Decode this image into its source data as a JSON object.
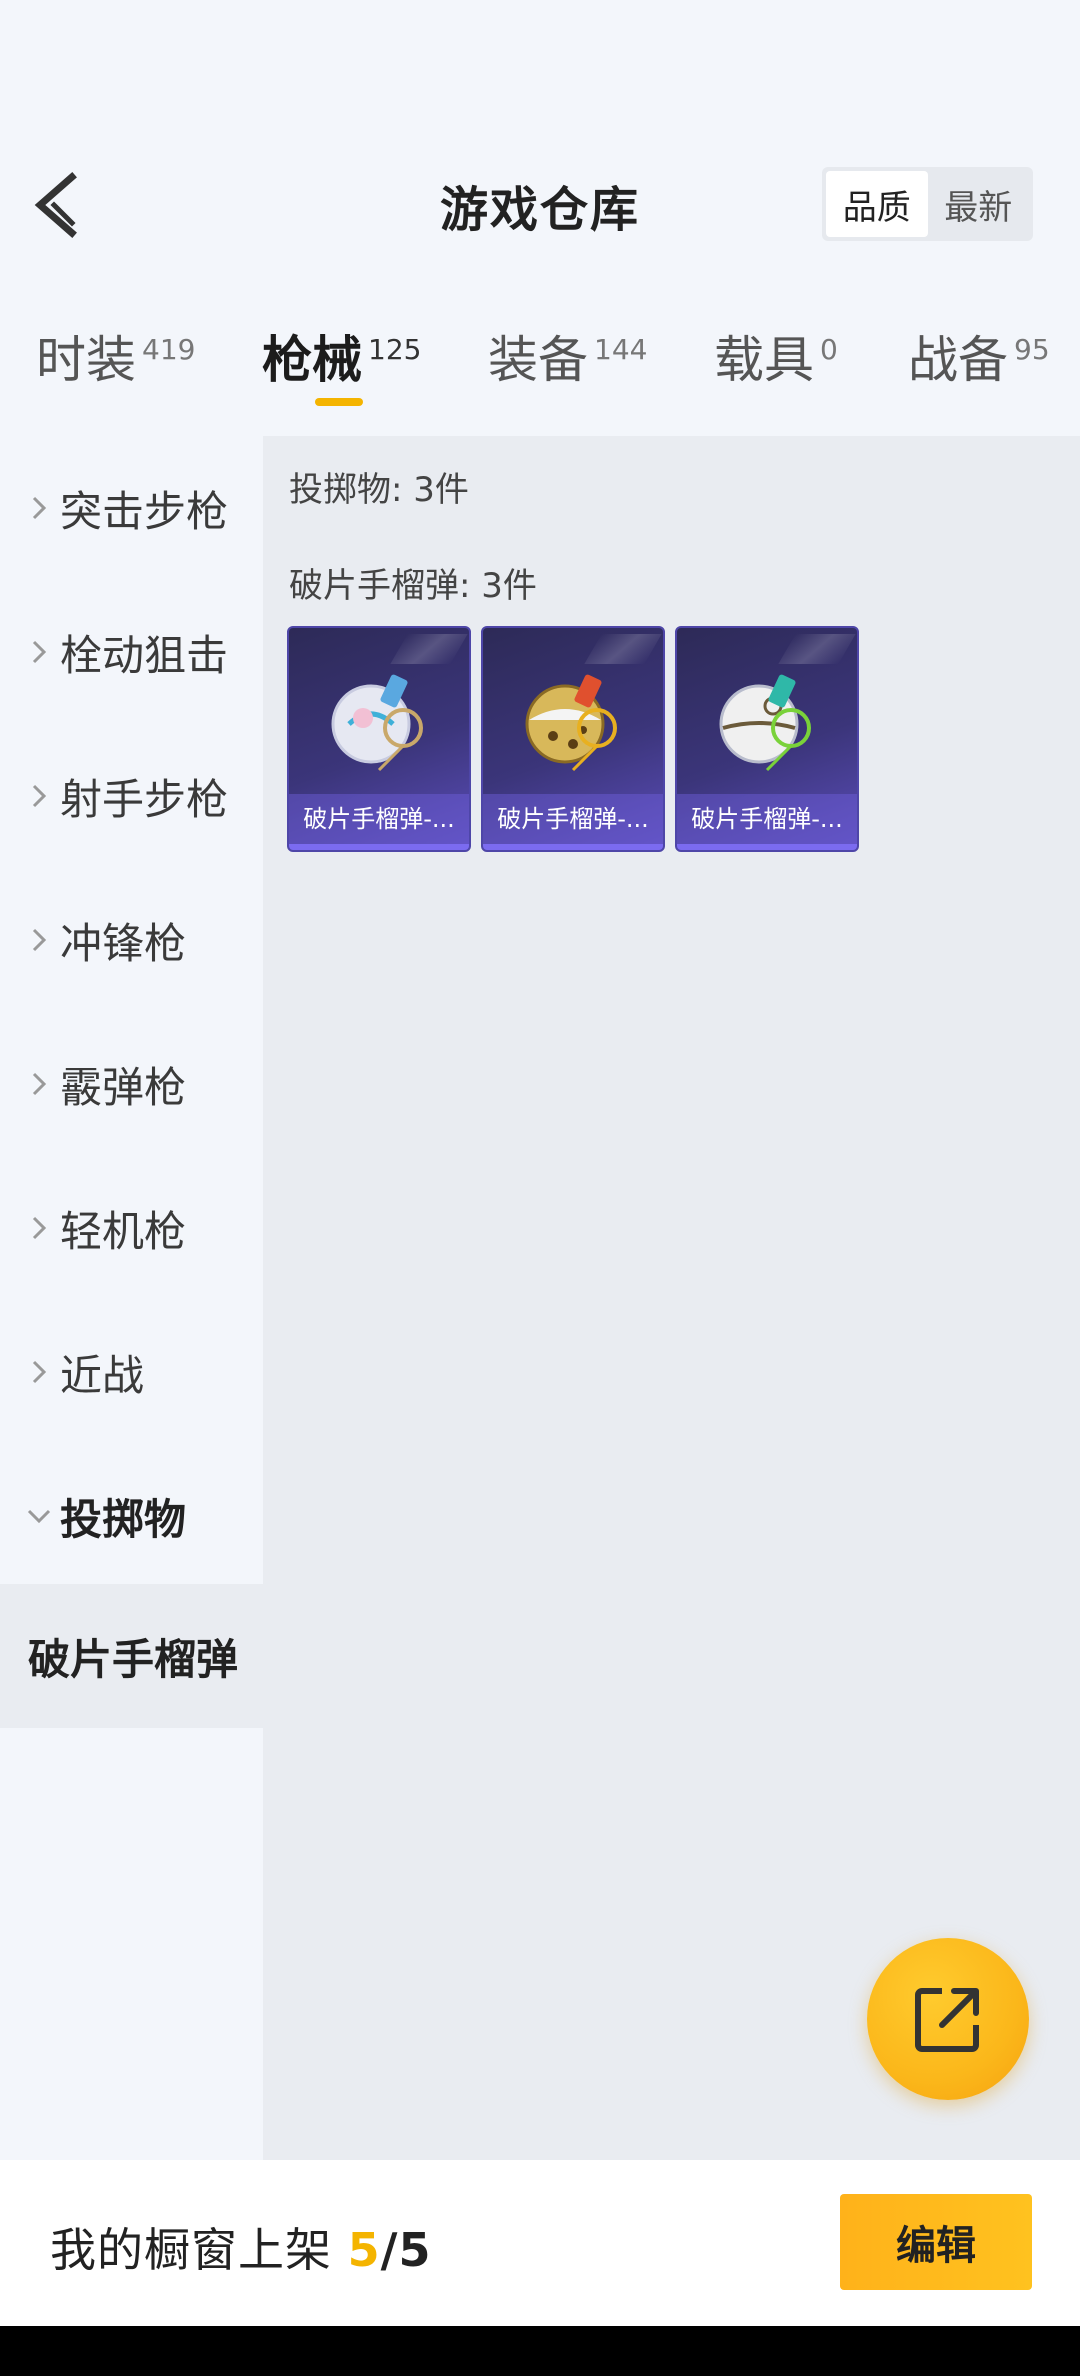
{
  "header": {
    "title": "游戏仓库",
    "back_icon": "chevron-left-icon",
    "sort_options": [
      {
        "label": "品质",
        "active": true
      },
      {
        "label": "最新",
        "active": false
      }
    ]
  },
  "tabs": [
    {
      "label": "时装",
      "count": "419",
      "active": false
    },
    {
      "label": "枪械",
      "count": "125",
      "active": true
    },
    {
      "label": "装备",
      "count": "144",
      "active": false
    },
    {
      "label": "载具",
      "count": "0",
      "active": false
    },
    {
      "label": "战备",
      "count": "95",
      "active": false
    }
  ],
  "sidebar": {
    "items": [
      {
        "label": "突击步枪",
        "state": "collapsed"
      },
      {
        "label": "栓动狙击",
        "state": "collapsed"
      },
      {
        "label": "射手步枪",
        "state": "collapsed"
      },
      {
        "label": "冲锋枪",
        "state": "collapsed"
      },
      {
        "label": "霰弹枪",
        "state": "collapsed"
      },
      {
        "label": "轻机枪",
        "state": "collapsed"
      },
      {
        "label": "近战",
        "state": "collapsed"
      },
      {
        "label": "投掷物",
        "state": "expanded"
      }
    ],
    "sub_item": {
      "label": "破片手榴弹",
      "selected": true
    }
  },
  "content": {
    "category_count_label": "投掷物: 3件",
    "subcategory_count_label": "破片手榴弹: 3件",
    "items": [
      {
        "caption": "破片手榴弹-..."
      },
      {
        "caption": "破片手榴弹-..."
      },
      {
        "caption": "破片手榴弹-..."
      }
    ]
  },
  "fab": {
    "icon": "share-external-icon"
  },
  "bottom_bar": {
    "label": "我的橱窗上架 ",
    "current": "5",
    "total": "/5",
    "edit_button": "编辑"
  },
  "colors": {
    "accent": "#f4b400",
    "card_bg": "#3b357a",
    "page_bg": "#f3f6fb",
    "content_bg": "#e9ecf1"
  }
}
